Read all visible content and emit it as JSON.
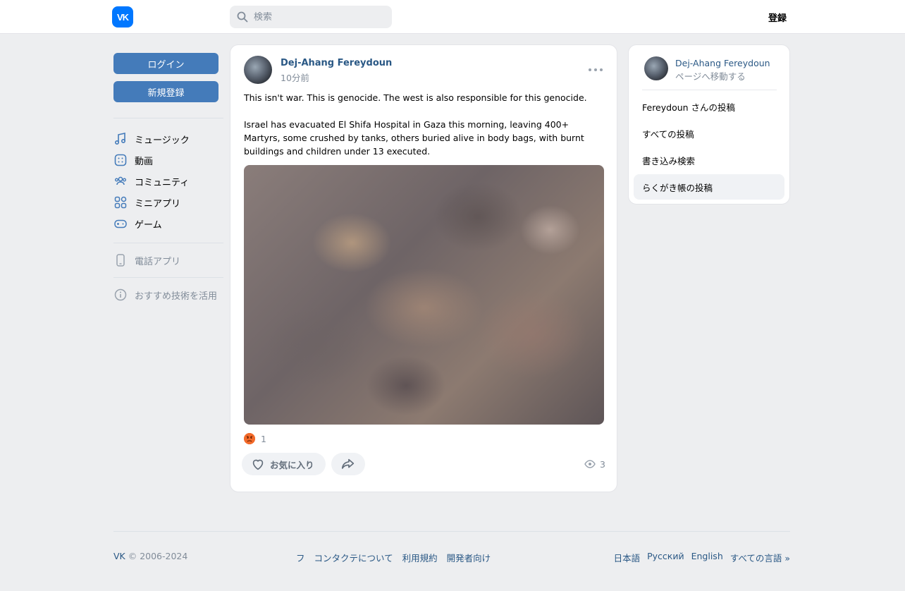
{
  "header": {
    "logo_text": "VK",
    "search_placeholder": "検索",
    "register_label": "登録"
  },
  "left_nav": {
    "login_label": "ログイン",
    "signup_label": "新規登録",
    "items": [
      {
        "label": "ミュージック",
        "icon": "music-icon"
      },
      {
        "label": "動画",
        "icon": "video-icon"
      },
      {
        "label": "コミュニティ",
        "icon": "community-icon"
      },
      {
        "label": "ミニアプリ",
        "icon": "mini-apps-icon"
      },
      {
        "label": "ゲーム",
        "icon": "gamepad-icon"
      }
    ],
    "phone_app_label": "電話アプリ",
    "tech_label": "おすすめ技術を活用"
  },
  "post": {
    "author": "Dej-Ahang Fereydoun",
    "time": "10分前",
    "text_1": "This isn't war. This is genocide. The west is also responsible for this genocide.",
    "text_2": "Israel has evacuated El Shifa Hospital in Gaza this morning, leaving 400+ Martyrs, some crushed by tanks, others buried alive in body bags, with burnt buildings and children under 13 executed.",
    "reaction_count": "1",
    "like_label": "お気に入り",
    "views": "3"
  },
  "side": {
    "name": "Dej-Ahang Fereydoun",
    "sub": "ページへ移動する",
    "items": [
      {
        "label": "Fereydoun さんの投稿"
      },
      {
        "label": "すべての投稿"
      },
      {
        "label": "書き込み検索"
      },
      {
        "label": "らくがき帳の投稿"
      }
    ]
  },
  "footer": {
    "brand": "VK",
    "copyright": " © 2006-2024",
    "links": [
      "フ",
      "コンタクテについて",
      "利用規約",
      "開発者向け"
    ],
    "languages": [
      "日本語",
      "Русский",
      "English",
      "すべての言語 »"
    ]
  },
  "colors": {
    "accent": "#447bba",
    "link": "#2a5885",
    "logo": "#0077ff",
    "background": "#edeef0"
  }
}
